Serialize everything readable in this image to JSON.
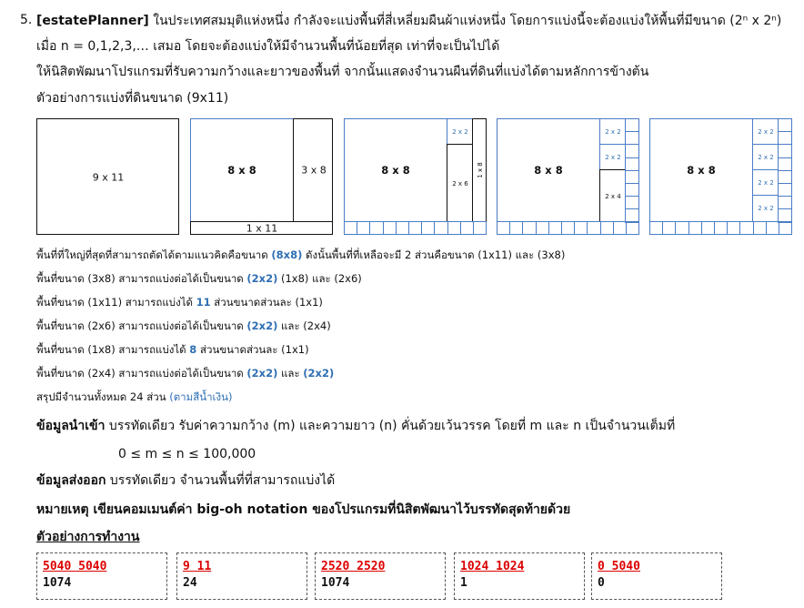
{
  "problem": {
    "number": "5.",
    "tag": "[estatePlanner]",
    "intro_rest": "ในประเทศสมมุติแห่งหนึ่ง กำลังจะแบ่งพื้นที่สี่เหลี่ยมผืนผ้าแห่งหนึ่ง โดยการแบ่งนี้จะต้องแบ่งให้พื้นที่มีขนาด",
    "size_formula": "(2ⁿ x 2ⁿ)",
    "line2": "เมื่อ n = 0,1,2,3,… เสมอ โดยจะต้องแบ่งให้มีจำนวนพื้นที่น้อยที่สุด เท่าที่จะเป็นไปได้",
    "line3": "ให้นิสิตพัฒนาโปรแกรมที่รับความกว้างและยาวของพื้นที่ จากนั้นแสดงจำนวนผืนที่ดินที่แบ่งได้ตามหลักการข้างต้น",
    "line4": "ตัวอย่างการแบ่งที่ดินขนาด (9x11)"
  },
  "figures": {
    "f1_label": "9 x 11",
    "f2_big": "8 x 8",
    "f2_right": "3 x 8",
    "f2_bottom": "1 x 11",
    "f3_big": "8 x 8",
    "f3_2x2": "2 x 2",
    "f3_2x6": "2 x 6",
    "f3_1x8": "1 x 8",
    "f4_big": "8 x 8",
    "f4_2x2a": "2 x 2",
    "f4_2x2b": "2 x 2",
    "f4_2x4": "2 x 4",
    "f5_big": "8 x 8",
    "f5_2x2a": "2 x 2",
    "f5_2x2b": "2 x 2",
    "f5_2x2c": "2 x 2",
    "f5_2x2d": "2 x 2"
  },
  "explain": {
    "l1a": "พื้นที่ที่ใหญ่ที่สุดที่สามารถตัดได้ตามแนวคิดคือขนาด",
    "l1b": "(8x8)",
    "l1c": "ดังนั้นพื้นที่ที่เหลือจะมี 2 ส่วนคือขนาด (1x11) และ (3x8)",
    "l2a": "พื้นที่ขนาด (3x8) สามารถแบ่งต่อได้เป็นขนาด",
    "l2b": "(2x2)",
    "l2c": "(1x8) และ (2x6)",
    "l3a": "พื้นที่ขนาด (1x11) สามารถแบ่งได้",
    "l3b": "11",
    "l3c": "ส่วนขนาดส่วนละ (1x1)",
    "l4a": "พื้นที่ขนาด (2x6) สามารถแบ่งต่อได้เป็นขนาด",
    "l4b": "(2x2)",
    "l4c": "และ (2x4)",
    "l5a": "พื้นที่ขนาด (1x8) สามารถแบ่งได้",
    "l5b": "8",
    "l5c": "ส่วนขนาดส่วนละ (1x1)",
    "l6a": "พื้นที่ขนาด (2x4) สามารถแบ่งต่อได้เป็นขนาด",
    "l6b": "(2x2)",
    "l6c": "และ",
    "l6d": "(2x2)",
    "l7a": "สรุปมีจำนวนทั้งหมด 24 ส่วน",
    "l7b": "(ตามสีน้ำเงิน)"
  },
  "io": {
    "input_title": "ข้อมูลนำเข้า",
    "input_text": "บรรทัดเดียว รับค่าความกว้าง (m) และความยาว (n) คั่นด้วยเว้นวรรค โดยที่ m และ n เป็นจำนวนเต็มที่",
    "constraint": "0 ≤ m ≤ n ≤ 100,000",
    "output_title": "ข้อมูลส่งออก",
    "output_text": "บรรทัดเดียว จำนวนพื้นที่ที่สามารถแบ่งได้",
    "note": "หมายเหตุ เขียนคอมเมนต์ค่า big-oh notation ของโปรแกรมที่นิสิตพัฒนาไว้บรรทัดสุดท้ายด้วย",
    "examples_title": "ตัวอย่างการทำงาน"
  },
  "examples": [
    {
      "input": "5040 5040",
      "output": "1074"
    },
    {
      "input": "9 11",
      "output": "24"
    },
    {
      "input": "2520 2520",
      "output": "1074"
    },
    {
      "input": "1024 1024",
      "output": "1"
    },
    {
      "input": "0 5040",
      "output": "0"
    }
  ],
  "colors": {
    "accent_blue": "#2f6fb3",
    "box_blue": "#4a7cc6",
    "input_red": "#d00000"
  }
}
